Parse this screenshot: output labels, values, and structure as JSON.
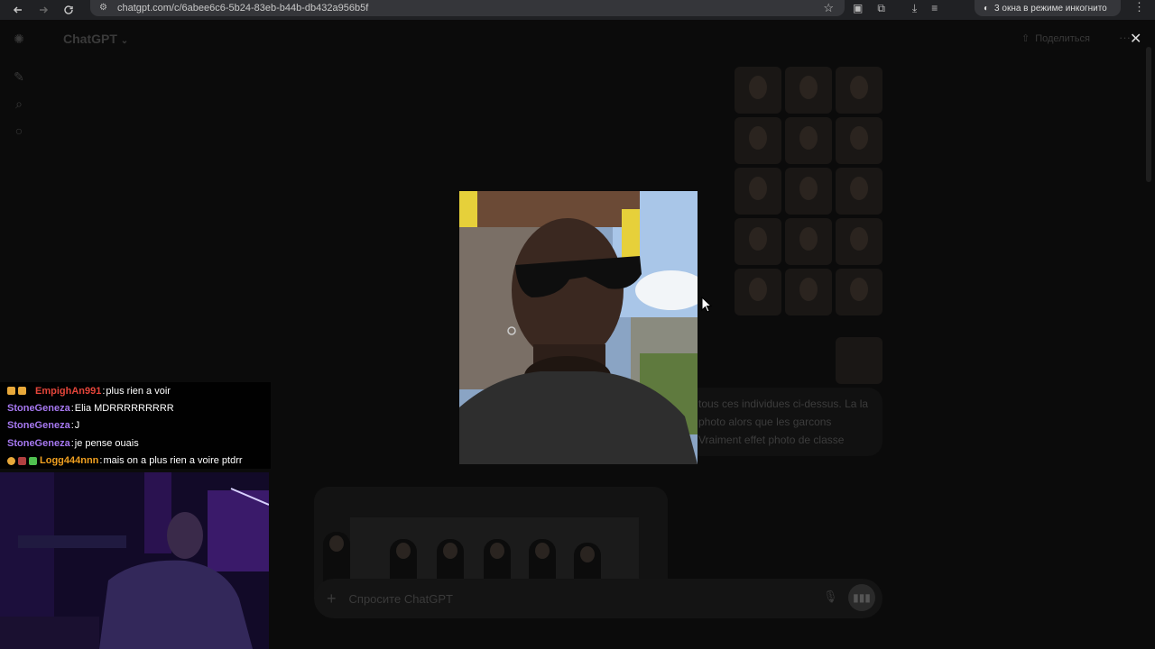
{
  "browser": {
    "url": "chatgpt.com/c/6abee6c6-5b24-83eb-b44b-db432a956b5f",
    "incognito_label": "3 окна в режиме инкогнито"
  },
  "app": {
    "title": "ChatGPT",
    "share_label": "Поделиться",
    "composer_placeholder": "Спросите ChatGPT",
    "assistant_text": "tous ces individues ci-dessus. La la photo alors que les garcons Vraiment effet photo de classe"
  },
  "chat": {
    "messages": [
      {
        "user": "EmpighAn991",
        "text": "plus rien a voir",
        "color": "#e4453a"
      },
      {
        "user": "StoneGeneza",
        "text": "Elia MDRRRRRRRRR",
        "color": "#a678f0"
      },
      {
        "user": "StoneGeneza",
        "text": "J",
        "color": "#a678f0"
      },
      {
        "user": "StoneGeneza",
        "text": "je pense ouais",
        "color": "#a678f0"
      },
      {
        "user": "Logg444nnn",
        "text": "mais on a plus rien a voire ptdrr",
        "color": "#f0a020"
      }
    ]
  },
  "icons": {
    "back": "arrow-left-icon",
    "forward": "arrow-right-icon",
    "reload": "reload-icon",
    "bookmark": "star-icon",
    "new_chat": "edit-icon",
    "search": "search-icon",
    "close": "close-icon"
  }
}
